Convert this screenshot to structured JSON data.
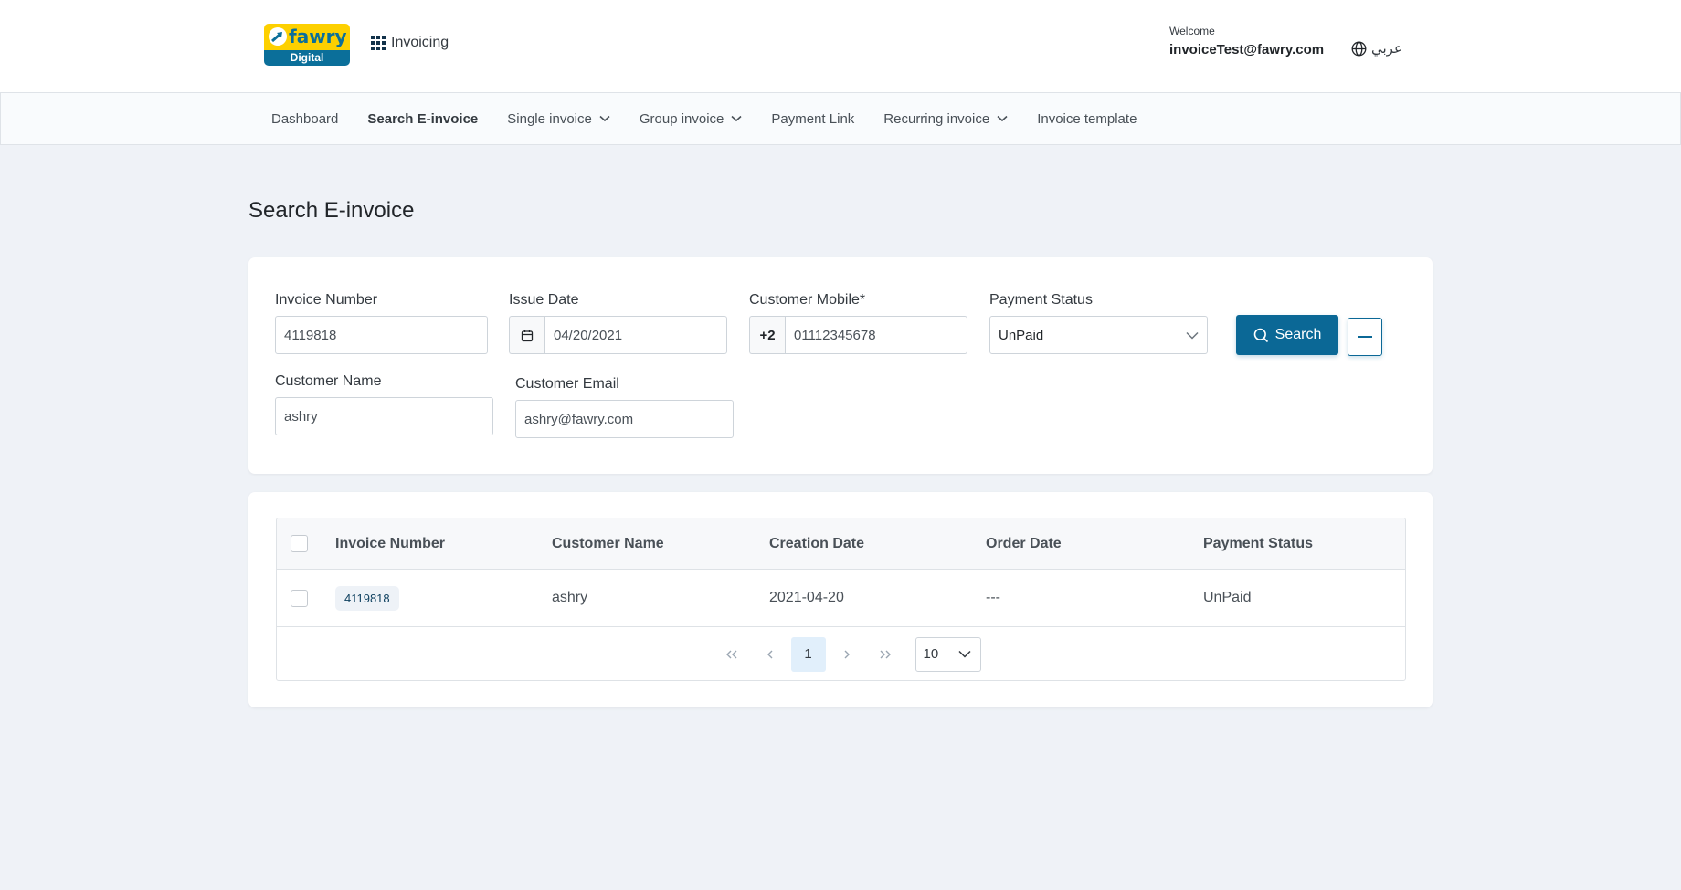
{
  "header": {
    "logo": {
      "word": "fawry",
      "sub": "Digital",
      "brand_yellow": "#fdd000",
      "brand_blue": "#0b6f9a"
    },
    "app_switch": {
      "icon": "grid-icon",
      "label": "Invoicing"
    },
    "user": {
      "welcome": "Welcome",
      "email": "invoiceTest@fawry.com"
    },
    "language": {
      "icon": "globe-icon",
      "label": "عربي"
    }
  },
  "nav": {
    "items": [
      {
        "label": "Dashboard",
        "active": false,
        "dropdown": false
      },
      {
        "label": "Search E-invoice",
        "active": true,
        "dropdown": false
      },
      {
        "label": "Single invoice",
        "active": false,
        "dropdown": true
      },
      {
        "label": "Group invoice",
        "active": false,
        "dropdown": true
      },
      {
        "label": "Payment Link",
        "active": false,
        "dropdown": false
      },
      {
        "label": "Recurring invoice",
        "active": false,
        "dropdown": true
      },
      {
        "label": "Invoice template",
        "active": false,
        "dropdown": false
      }
    ]
  },
  "page": {
    "title": "Search E-invoice"
  },
  "search_form": {
    "invoice_number": {
      "label": "Invoice Number",
      "value": "4119818"
    },
    "issue_date": {
      "label": "Issue Date",
      "value": "04/20/2021",
      "icon": "calendar-icon"
    },
    "customer_mobile": {
      "label": "Customer Mobile*",
      "prefix": "+2",
      "value": "01112345678"
    },
    "payment_status": {
      "label": "Payment Status",
      "value": "UnPaid"
    },
    "customer_name": {
      "label": "Customer Name",
      "value": "ashry"
    },
    "customer_email": {
      "label": "Customer Email",
      "value": "ashry@fawry.com"
    },
    "search_button": {
      "label": "Search",
      "icon": "search-icon"
    },
    "collapse_button": {
      "icon": "minus-icon"
    },
    "accent_color": "#0b6896"
  },
  "results": {
    "columns": [
      "Invoice Number",
      "Customer Name",
      "Creation Date",
      "Order Date",
      "Payment Status"
    ],
    "rows": [
      {
        "invoice_number": "4119818",
        "customer_name": "ashry",
        "creation_date": "2021-04-20",
        "order_date": "---",
        "payment_status": "UnPaid"
      }
    ],
    "pagination": {
      "first": "«",
      "prev": "‹",
      "current_page": "1",
      "next": "›",
      "last": "»",
      "page_size": "10"
    }
  }
}
